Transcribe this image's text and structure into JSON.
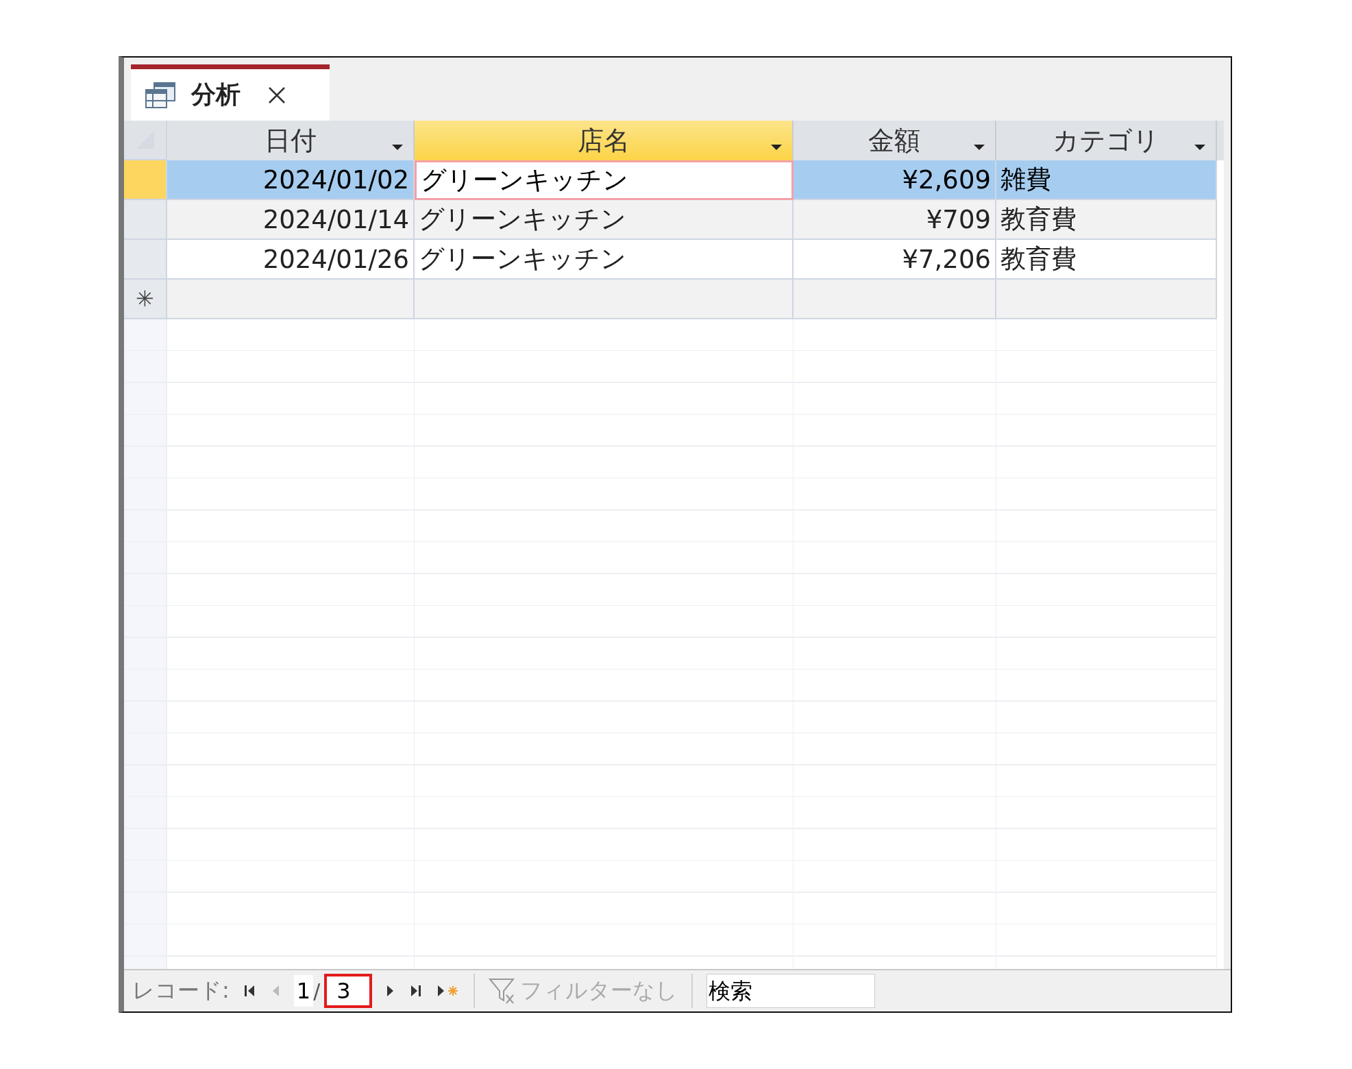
{
  "tab": {
    "title": "分析",
    "selected": true
  },
  "columns": [
    {
      "label": "日付",
      "kind": "date",
      "selected": false
    },
    {
      "label": "店名",
      "kind": "text",
      "selected": true
    },
    {
      "label": "金額",
      "kind": "amount",
      "selected": false
    },
    {
      "label": "カテゴリ",
      "kind": "text",
      "selected": false
    }
  ],
  "rows": [
    {
      "selected": true,
      "cells": [
        {
          "text": "2024/01/02",
          "focused": false
        },
        {
          "text": "グリーンキッチン",
          "focused": true
        },
        {
          "text": "¥2,609",
          "focused": false
        },
        {
          "text": "雑費",
          "focused": false
        }
      ]
    },
    {
      "selected": false,
      "cells": [
        {
          "text": "2024/01/14",
          "focused": false
        },
        {
          "text": "グリーンキッチン",
          "focused": false
        },
        {
          "text": "¥709",
          "focused": false
        },
        {
          "text": "教育費",
          "focused": false
        }
      ]
    },
    {
      "selected": false,
      "cells": [
        {
          "text": "2024/01/26",
          "focused": false
        },
        {
          "text": "グリーンキッチン",
          "focused": false
        },
        {
          "text": "¥7,206",
          "focused": false
        },
        {
          "text": "教育費",
          "focused": false
        }
      ]
    }
  ],
  "new_record_marker": "✳",
  "navigator": {
    "label": "レコード:",
    "current": "1",
    "separator": "/",
    "total": "3",
    "total_highlighted": true,
    "prev_disabled": true,
    "filter": {
      "label": "フィルターなし",
      "disabled": true
    },
    "search": {
      "placeholder": "検索"
    }
  }
}
